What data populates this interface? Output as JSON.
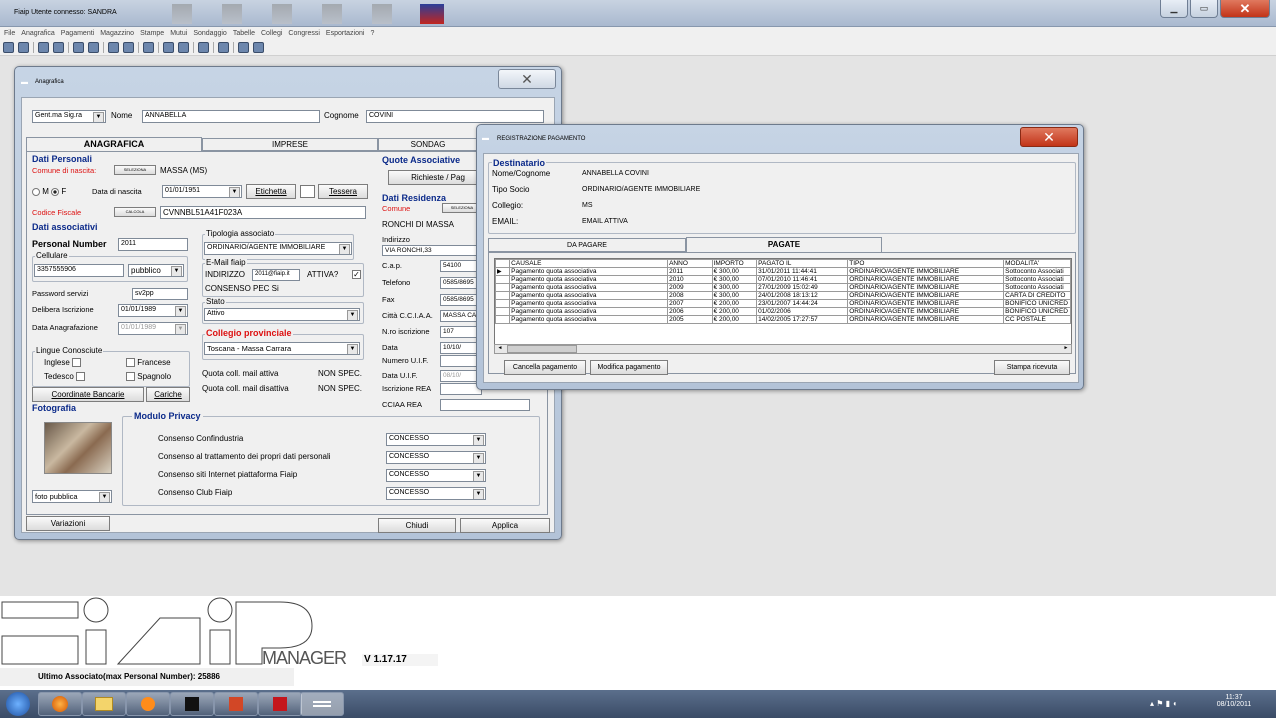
{
  "app": {
    "title": "Fiaip   Utente connesso: SANDRA"
  },
  "menu": [
    "File",
    "Anagrafica",
    "Pagamenti",
    "Magazzino",
    "Stampe",
    "Mutui",
    "Sondaggio",
    "Tabelle",
    "Collegi",
    "Congressi",
    "Esportazioni",
    "?"
  ],
  "anagrafica": {
    "title": "Anagrafica",
    "salutation": "Gent.ma Sig.ra",
    "nome_label": "Nome",
    "nome": "ANNABELLA",
    "cognome_label": "Cognome",
    "cognome": "COVINI",
    "tabs": [
      "ANAGRAFICA",
      "IMPRESE",
      "SONDAG"
    ],
    "dati_personali": "Dati Personali",
    "comune_nascita_label": "Comune di nascita:",
    "seleziona": "SELEZIONA",
    "comune_nascita": "MASSA (MS)",
    "sex_m": "M",
    "sex_f": "F",
    "data_nascita_label": "Data di nascita",
    "data_nascita": "01/01/1951",
    "etichetta": "Etichetta",
    "tessera": "Tessera",
    "codice_fiscale_label": "Codice Fiscale",
    "calcola": "CALCOLA",
    "codice_fiscale": "CVNNBL51A41F023A",
    "dati_associativi": "Dati associativi",
    "personal_number_label": "Personal Number",
    "personal_number": "2011",
    "tipologia_label": "Tipologia associato",
    "tipologia": "ORDINARIO/AGENTE IMMOBILIARE",
    "cellulare_label": "Cellulare",
    "cellulare": "3357555906",
    "cellulare_type": "pubblico",
    "email_label": "E-Mail fiaip",
    "indirizzo_label": "INDIRIZZO",
    "indirizzo": "2011@fiaip.it",
    "attiva_label": "ATTIVA?",
    "pec": "CONSENSO PEC Si",
    "password_label": "Password servizi",
    "password": "sv2pp",
    "delibera_label": "Delibera Iscrizione",
    "delibera": "01/01/1989",
    "stato_label": "Stato",
    "stato": "Attivo",
    "data_anagrafazione_label": "Data Anagrafazione",
    "data_anagrafazione": "01/01/1989",
    "collegio_label": "Collegio provinciale",
    "collegio": "Toscana - Massa Carrara",
    "lingue_label": "Lingue Conosciute",
    "inglese": "Inglese",
    "francese": "Francese",
    "tedesco": "Tedesco",
    "spagnolo": "Spagnolo",
    "quota_attiva_label": "Quota coll. mail attiva",
    "quota_attiva": "NON SPEC.",
    "quota_disattiva_label": "Quota coll. mail disattiva",
    "quota_disattiva": "NON SPEC.",
    "coordinate_bancarie": "Coordinate Bancarie",
    "cariche": "Cariche",
    "fotografia": "Fotografia",
    "foto_mode": "foto pubblica",
    "privacy_title": "Modulo Privacy",
    "privacy": [
      {
        "label": "Consenso Confindustria",
        "value": "CONCESSO"
      },
      {
        "label": "Consenso al trattamento dei propri dati personali",
        "value": "CONCESSO"
      },
      {
        "label": "Consenso siti Internet piattaforma Fiaip",
        "value": "CONCESSO"
      },
      {
        "label": "Consenso Club Fiaip",
        "value": "CONCESSO"
      }
    ],
    "quote_title": "Quote Associative",
    "richieste": "Richieste / Pag",
    "dati_residenza": "Dati Residenza",
    "comune_label": "Comune",
    "comune": "RONCHI DI MASSA",
    "indirizzo_res_label": "Indirizzo",
    "indirizzo_res": "VIA RONCHI,33",
    "cap_label": "C.a.p.",
    "cap": "54100",
    "telefono_label": "Telefono",
    "telefono": "0585/8695",
    "fax_label": "Fax",
    "fax": "0585/8695",
    "citta_cciaa_label": "Città C.C.I.A.A.",
    "citta_cciaa": "MASSA CA",
    "nro_iscrizione_label": "N.ro iscrizione",
    "nro_iscrizione": "107",
    "data_label": "Data",
    "data": "10/10/",
    "numero_uif_label": "Numero U.I.F.",
    "data_uif_label": "Data U.I.F.",
    "data_uif": "08/10/",
    "iscrizione_rea_label": "Iscrizione REA",
    "cciaa_rea_label": "CCIAA REA",
    "variazioni": "Variazioni",
    "chiudi": "Chiudi",
    "applica": "Applica"
  },
  "pagamento": {
    "title": "REGISTRAZIONE PAGAMENTO",
    "destinatario": "Destinatario",
    "rows": [
      {
        "label": "Nome/Cognome",
        "value": "ANNABELLA COVINI"
      },
      {
        "label": "Tipo Socio",
        "value": "ORDINARIO/AGENTE IMMOBILIARE"
      },
      {
        "label": "Collegio:",
        "value": "MS"
      },
      {
        "label": "EMAIL:",
        "value": "EMAIL ATTIVA"
      }
    ],
    "tab_da_pagare": "DA PAGARE",
    "tab_pagate": "PAGATE",
    "columns": [
      "CAUSALE",
      "ANNO",
      "IMPORTO",
      "PAGATO IL",
      "TIPO",
      "MODALITA'"
    ],
    "table": [
      [
        "Pagamento quota associativa",
        "2011",
        "€ 300,00",
        "31/01/2011 11:44:41",
        "ORDINARIO/AGENTE IMMOBILIARE",
        "Sottoconto Associati"
      ],
      [
        "Pagamento quota associativa",
        "2010",
        "€ 300,00",
        "07/01/2010 11:46:41",
        "ORDINARIO/AGENTE IMMOBILIARE",
        "Sottoconto Associati"
      ],
      [
        "Pagamento quota associativa",
        "2009",
        "€ 300,00",
        "27/01/2009 15:02:49",
        "ORDINARIO/AGENTE IMMOBILIARE",
        "Sottoconto Associati"
      ],
      [
        "Pagamento quota associativa",
        "2008",
        "€ 300,00",
        "24/01/2008 18:13:12",
        "ORDINARIO/AGENTE IMMOBILIARE",
        "CARTA DI CREDITO"
      ],
      [
        "Pagamento quota associativa",
        "2007",
        "€ 200,00",
        "23/01/2007 14:44:24",
        "ORDINARIO/AGENTE IMMOBILIARE",
        "BONIFICO UNICRED"
      ],
      [
        "Pagamento quota associativa",
        "2006",
        "€ 200,00",
        "01/02/2006",
        "ORDINARIO/AGENTE IMMOBILIARE",
        "BONIFICO UNICRED"
      ],
      [
        "Pagamento quota associativa",
        "2005",
        "€ 200,00",
        "14/02/2005 17:27:57",
        "ORDINARIO/AGENTE IMMOBILIARE",
        "CC POSTALE"
      ]
    ],
    "cancella": "Cancella pagamento",
    "modifica": "Modifica pagamento",
    "stampa": "Stampa ricevuta"
  },
  "footer": {
    "manager": "MANAGER",
    "version": "V 1.17.17",
    "ultimo": "Ultimo Associato(max Personal Number): 25886"
  },
  "tray": {
    "time": "11:37",
    "date": "08/10/2011"
  }
}
